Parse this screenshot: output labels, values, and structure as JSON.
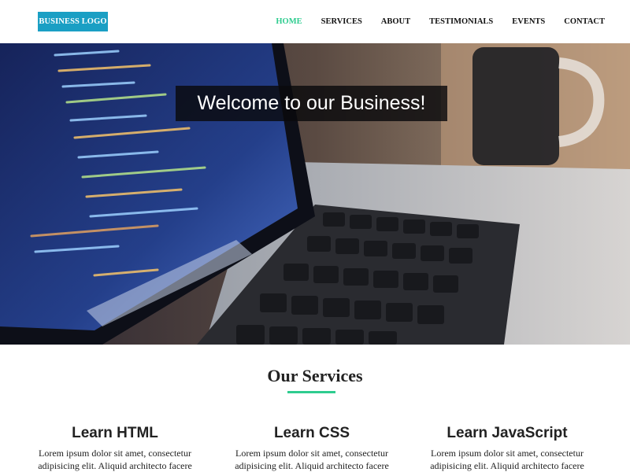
{
  "header": {
    "logo_text": "BUSINESS LOGO",
    "nav": [
      {
        "label": "HOME",
        "active": true
      },
      {
        "label": "SERVICES",
        "active": false
      },
      {
        "label": "ABOUT",
        "active": false
      },
      {
        "label": "TESTIMONIALS",
        "active": false
      },
      {
        "label": "EVENTS",
        "active": false
      },
      {
        "label": "CONTACT",
        "active": false
      }
    ]
  },
  "hero": {
    "title": "Welcome to our Business!"
  },
  "services": {
    "heading": "Our Services",
    "items": [
      {
        "title": "Learn HTML",
        "text": "Lorem ipsum dolor sit amet, consectetur adipisicing elit. Aliquid architecto facere dignissimos quae,"
      },
      {
        "title": "Learn CSS",
        "text": "Lorem ipsum dolor sit amet, consectetur adipisicing elit. Aliquid architecto facere dignissimos quae,"
      },
      {
        "title": "Learn JavaScript",
        "text": "Lorem ipsum dolor sit amet, consectetur adipisicing elit. Aliquid architecto facere dignissimos quae,"
      }
    ]
  },
  "colors": {
    "accent": "#2ecc8f",
    "logo_bg": "#1a9fc4"
  }
}
